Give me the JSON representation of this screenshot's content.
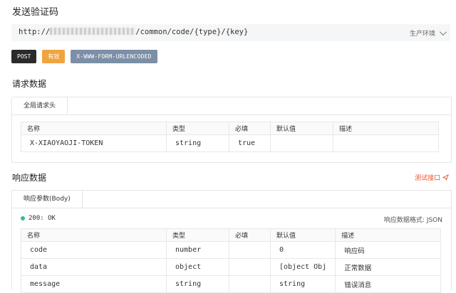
{
  "title": "发送验证码",
  "url": {
    "prefix": "http://",
    "path": "/common/code/{type}/{key}",
    "env": "生产环境"
  },
  "tags": [
    "POST",
    "有效",
    "X-WWW-FORM-URLENCODED"
  ],
  "request": {
    "section_title": "请求数据",
    "tab": "全局请求头",
    "headers": [
      "名称",
      "类型",
      "必填",
      "默认值",
      "描述"
    ],
    "rows": [
      [
        "X-XIAOYAOJI-TOKEN",
        "string",
        "true",
        "",
        ""
      ]
    ]
  },
  "response": {
    "section_title": "响应数据",
    "test_link": "测试接口",
    "tab": "响应参数(Body)",
    "status": "200: OK",
    "format_label": "响应数据格式: JSON",
    "headers": [
      "名称",
      "类型",
      "必填",
      "默认值",
      "描述"
    ],
    "rows": [
      [
        "code",
        "number",
        "",
        "0",
        "响应码"
      ],
      [
        "data",
        "object",
        "",
        "[object Obj",
        "正常数据"
      ],
      [
        "message",
        "string",
        "",
        "string",
        "错误消息"
      ]
    ]
  },
  "colors": {
    "post": "#2b2b2b",
    "valid": "#f0a441",
    "content_type": "#7d8fa6",
    "link": "#e4572e",
    "status_dot": "#2ec27e"
  }
}
